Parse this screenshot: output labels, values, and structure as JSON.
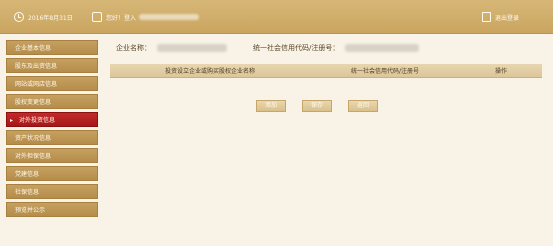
{
  "header": {
    "datetime": "2016年8月31日",
    "user_label": "您好！登入",
    "exit_label": "退出登录"
  },
  "sidebar": {
    "items": [
      {
        "label": "企业基本信息",
        "active": false
      },
      {
        "label": "股东及出资信息",
        "active": false
      },
      {
        "label": "网站或网店信息",
        "active": false
      },
      {
        "label": "股权变更信息",
        "active": false
      },
      {
        "label": "对外投资信息",
        "active": true
      },
      {
        "label": "资产状况信息",
        "active": false
      },
      {
        "label": "对外担保信息",
        "active": false
      },
      {
        "label": "党建信息",
        "active": false
      },
      {
        "label": "社保信息",
        "active": false
      },
      {
        "label": "预览并公示",
        "active": false
      }
    ]
  },
  "main": {
    "company_name_label": "企业名称：",
    "credit_code_label": "统一社会信用代码/注册号：",
    "table": {
      "headers": [
        "投资设立企业或购买股权企业名称",
        "统一社会信用代码/注册号",
        "操作"
      ]
    },
    "buttons": {
      "add": "添加",
      "save": "保存",
      "back": "返回"
    }
  }
}
